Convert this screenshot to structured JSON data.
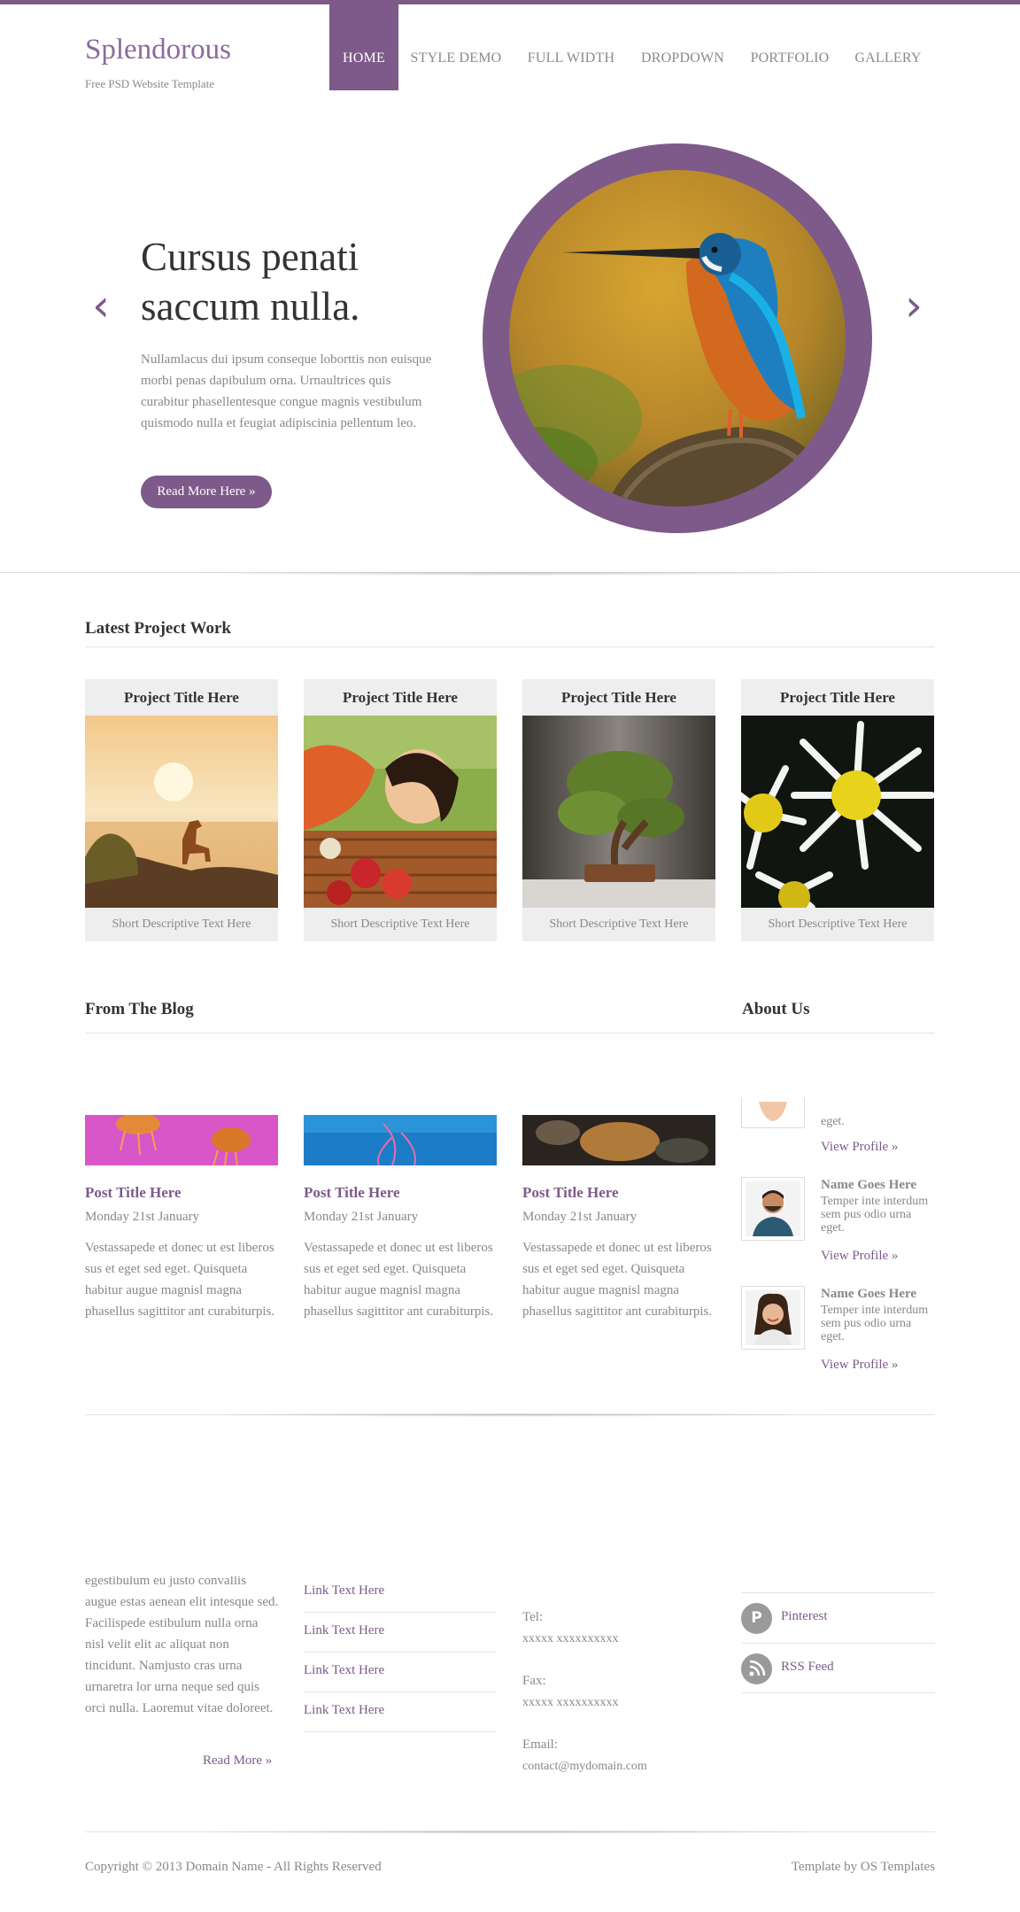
{
  "site": {
    "logo": "Splendorous",
    "tagline": "Free PSD Website Template"
  },
  "nav": {
    "items": [
      "HOME",
      "STYLE DEMO",
      "FULL WIDTH",
      "DROPDOWN",
      "PORTFOLIO",
      "GALLERY"
    ],
    "active": "HOME"
  },
  "hero": {
    "title": "Cursus penati saccum nulla.",
    "text": "Nullamlacus dui ipsum conseque loborttis non euisque morbi penas dapibulum orna. Urnaultrices quis curabitur phasellentesque congue magnis vestibulum quismodo nulla et feugiat adipiscinia pellentum leo.",
    "button": "Read More Here »",
    "prev_icon": "chevron-left-icon",
    "next_icon": "chevron-right-icon"
  },
  "projects": {
    "heading": "Latest Project Work",
    "items": [
      {
        "title": "Project Title Here",
        "desc": "Short Descriptive Text Here"
      },
      {
        "title": "Project Title Here",
        "desc": "Short Descriptive Text Here"
      },
      {
        "title": "Project Title Here",
        "desc": "Short Descriptive Text Here"
      },
      {
        "title": "Project Title Here",
        "desc": "Short Descriptive Text Here"
      }
    ]
  },
  "blog": {
    "heading": "From The Blog",
    "posts": [
      {
        "title": "Post Title Here",
        "date": "Monday 21st January",
        "text": "Vestassapede et donec ut est liberos sus et eget sed eget. Quisqueta habitur augue magnisl magna phasellus sagittitor ant curabiturpis."
      },
      {
        "title": "Post Title Here",
        "date": "Monday 21st January",
        "text": "Vestassapede et donec ut est liberos sus et eget sed eget. Quisqueta habitur augue magnisl magna phasellus sagittitor ant curabiturpis."
      },
      {
        "title": "Post Title Here",
        "date": "Monday 21st January",
        "text": "Vestassapede et donec ut est liberos sus et eget sed eget. Quisqueta habitur augue magnisl magna phasellus sagittitor ant curabiturpis."
      }
    ]
  },
  "about": {
    "heading": "About Us",
    "partial_text": "eget.",
    "members": [
      {
        "name": "Name Goes Here",
        "text": [
          "Temper inte interdum",
          "sem pus odio urna",
          "eget."
        ],
        "link": "View Profile »"
      },
      {
        "name": "Name Goes Here",
        "text": [
          "Temper inte interdum",
          "sem pus odio urna",
          "eget."
        ],
        "link": "View Profile »"
      }
    ],
    "first_link": "View Profile »"
  },
  "footer": {
    "about_text": "egestibulum eu justo convallis augue estas aenean elit intesque sed. Facilispede estibulum nulla orna nisl velit elit ac aliquat non tincidunt. Namjusto cras urna urnaretra lor urna neque sed quis orci nulla. Laoremut vitae doloreet.",
    "read_more": "Read More »",
    "links": [
      "Link Text Here",
      "Link Text Here",
      "Link Text Here",
      "Link Text Here"
    ],
    "contact": [
      {
        "label": "Tel:",
        "value": "xxxxx xxxxxxxxxx"
      },
      {
        "label": "Fax:",
        "value": "xxxxx xxxxxxxxxx"
      },
      {
        "label": "Email:",
        "value": "contact@mydomain.com"
      }
    ],
    "social": [
      {
        "label": "Pinterest",
        "icon": "pinterest-icon"
      },
      {
        "label": "RSS Feed",
        "icon": "rss-icon"
      }
    ],
    "copyright": "Copyright © 2013 Domain Name - All Rights Reserved",
    "credit": "Template by OS Templates"
  },
  "colors": {
    "accent": "#7d5a8a",
    "logo": "#8b6a9c",
    "text": "#888888"
  }
}
